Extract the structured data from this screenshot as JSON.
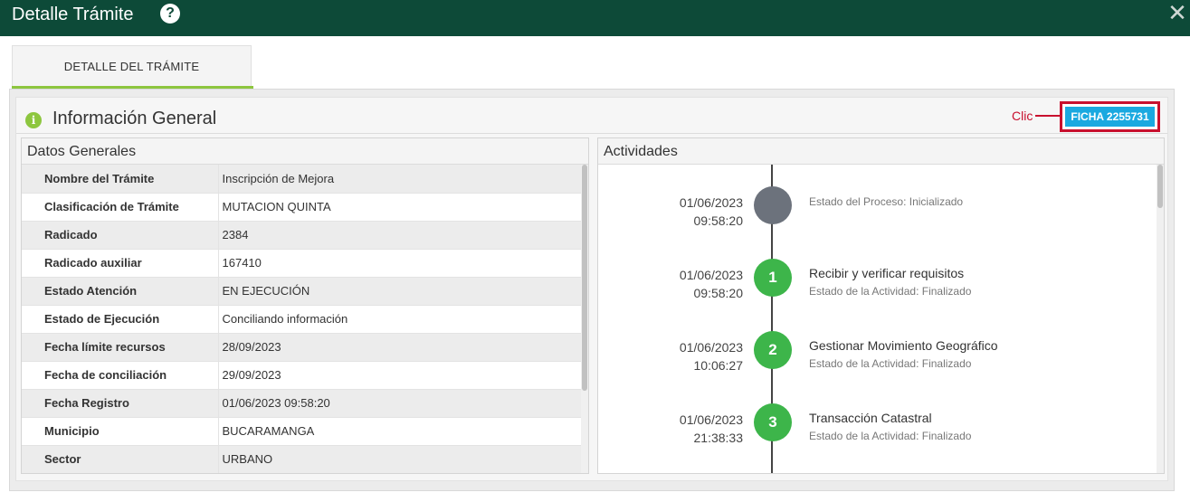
{
  "window": {
    "title": "Detalle Trámite",
    "help_icon": "?",
    "close_icon": "✕"
  },
  "tabs": [
    {
      "label": "DETALLE DEL TRÁMITE",
      "active": true
    }
  ],
  "info": {
    "title": "Información General",
    "icon": "i",
    "annotation": "Clic",
    "ficha_button": "FICHA 2255731"
  },
  "datos_generales": {
    "title": "Datos Generales",
    "rows": [
      {
        "label": "Nombre del Trámite",
        "value": "Inscripción de Mejora"
      },
      {
        "label": "Clasificación de Trámite",
        "value": "MUTACION QUINTA"
      },
      {
        "label": "Radicado",
        "value": "2384"
      },
      {
        "label": "Radicado auxiliar",
        "value": "167410"
      },
      {
        "label": "Estado Atención",
        "value": "EN EJECUCIÓN"
      },
      {
        "label": "Estado de Ejecución",
        "value": "Conciliando información"
      },
      {
        "label": "Fecha límite recursos",
        "value": "28/09/2023"
      },
      {
        "label": "Fecha de conciliación",
        "value": "29/09/2023"
      },
      {
        "label": "Fecha Registro",
        "value": "01/06/2023 09:58:20"
      },
      {
        "label": "Municipio",
        "value": "BUCARAMANGA"
      },
      {
        "label": "Sector",
        "value": "URBANO"
      }
    ]
  },
  "actividades": {
    "title": "Actividades",
    "items": [
      {
        "date": "01/06/2023",
        "time": "09:58:20",
        "node": "",
        "name": "",
        "state": "Estado del Proceso: Inicializado"
      },
      {
        "date": "01/06/2023",
        "time": "09:58:20",
        "node": "1",
        "name": "Recibir y verificar requisitos",
        "state": "Estado de la Actividad: Finalizado"
      },
      {
        "date": "01/06/2023",
        "time": "10:06:27",
        "node": "2",
        "name": "Gestionar Movimiento Geográfico",
        "state": "Estado de la Actividad: Finalizado"
      },
      {
        "date": "01/06/2023",
        "time": "21:38:33",
        "node": "3",
        "name": "Transacción Catastral",
        "state": "Estado de la Actividad: Finalizado"
      }
    ]
  },
  "colors": {
    "header": "#0d4a38",
    "accent": "#8dc63f",
    "ficha": "#1aa9e0",
    "annotation": "#c8102e",
    "done": "#3db54a",
    "init": "#6c727c"
  }
}
